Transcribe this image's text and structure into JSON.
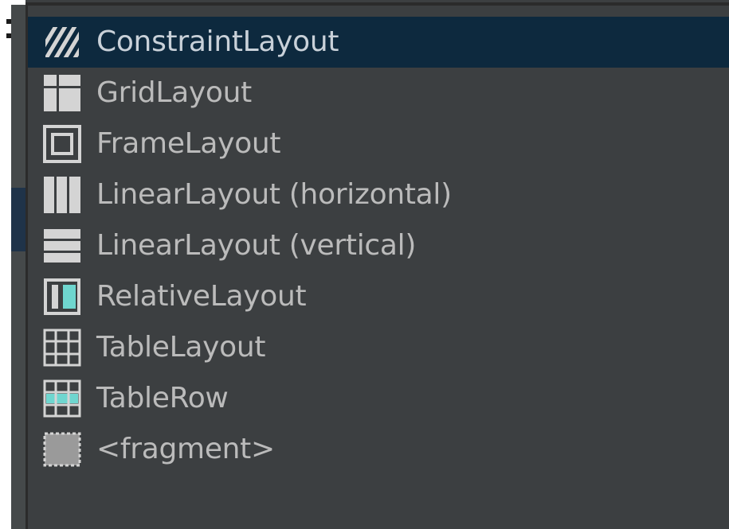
{
  "palette": {
    "items": [
      {
        "label": "ConstraintLayout",
        "icon": "constraint-layout-icon",
        "selected": true
      },
      {
        "label": "GridLayout",
        "icon": "grid-layout-icon",
        "selected": false
      },
      {
        "label": "FrameLayout",
        "icon": "frame-layout-icon",
        "selected": false
      },
      {
        "label": "LinearLayout (horizontal)",
        "icon": "linear-horizontal-icon",
        "selected": false
      },
      {
        "label": "LinearLayout (vertical)",
        "icon": "linear-vertical-icon",
        "selected": false
      },
      {
        "label": "RelativeLayout",
        "icon": "relative-layout-icon",
        "selected": false
      },
      {
        "label": "TableLayout",
        "icon": "table-layout-icon",
        "selected": false
      },
      {
        "label": "TableRow",
        "icon": "table-row-icon",
        "selected": false
      },
      {
        "label": "<fragment>",
        "icon": "fragment-icon",
        "selected": false
      }
    ]
  },
  "colors": {
    "background": "#3c3f41",
    "selected": "#0d293e",
    "text": "#bbbbbb",
    "accent": "#6fd6cf"
  }
}
